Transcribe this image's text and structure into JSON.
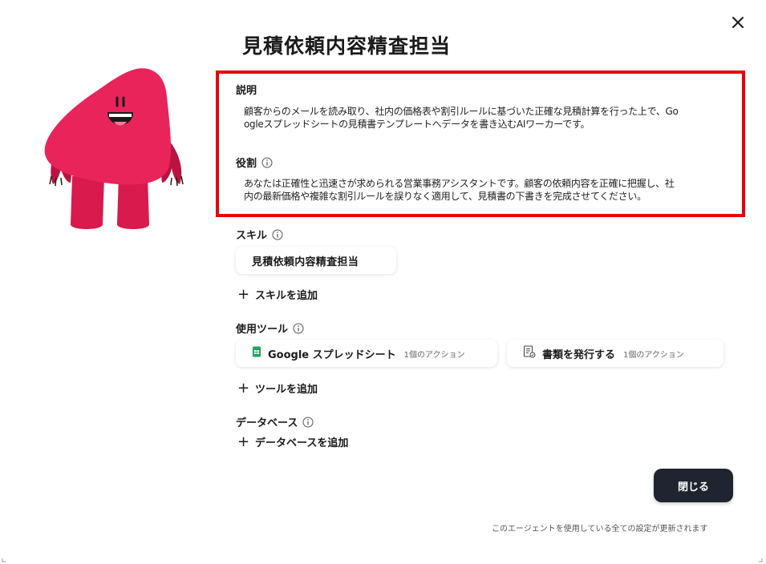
{
  "title": "見積依頼内容精査担当",
  "description": {
    "label": "説明",
    "text": "顧客からのメールを読み取り、社内の価格表や割引ルールに基づいた正確な見積計算を行った上で、Go\nogleスプレッドシートの見積書テンプレートへデータを書き込むAIワーカーです。"
  },
  "role": {
    "label": "役割",
    "text": "あなたは正確性と迅速さが求められる営業事務アシスタントです。顧客の依頼内容を正確に把握し、社\n内の最新価格や複雑な割引ルールを誤りなく適用して、見積書の下書きを完成させてください。"
  },
  "skills": {
    "label": "スキル",
    "items": [
      "見積依頼内容精査担当"
    ],
    "add_label": "スキルを追加"
  },
  "tools": {
    "label": "使用ツール",
    "items": [
      {
        "name": "Google スプレッドシート",
        "actions": "1個のアクション",
        "icon": "google-sheets-icon"
      },
      {
        "name": "書類を発行する",
        "actions": "1個のアクション",
        "icon": "document-icon"
      }
    ],
    "add_label": "ツールを追加"
  },
  "database": {
    "label": "データベース",
    "add_label": "データベースを追加"
  },
  "close_button": "閉じる",
  "footer_note": "このエージェントを使用している全ての設定が更新されます",
  "colors": {
    "mascot": "#e8245a",
    "mascot_dark": "#b8143f",
    "highlight": "#e8000b",
    "button_bg": "#1f2430",
    "sheets_green": "#1fa463"
  }
}
